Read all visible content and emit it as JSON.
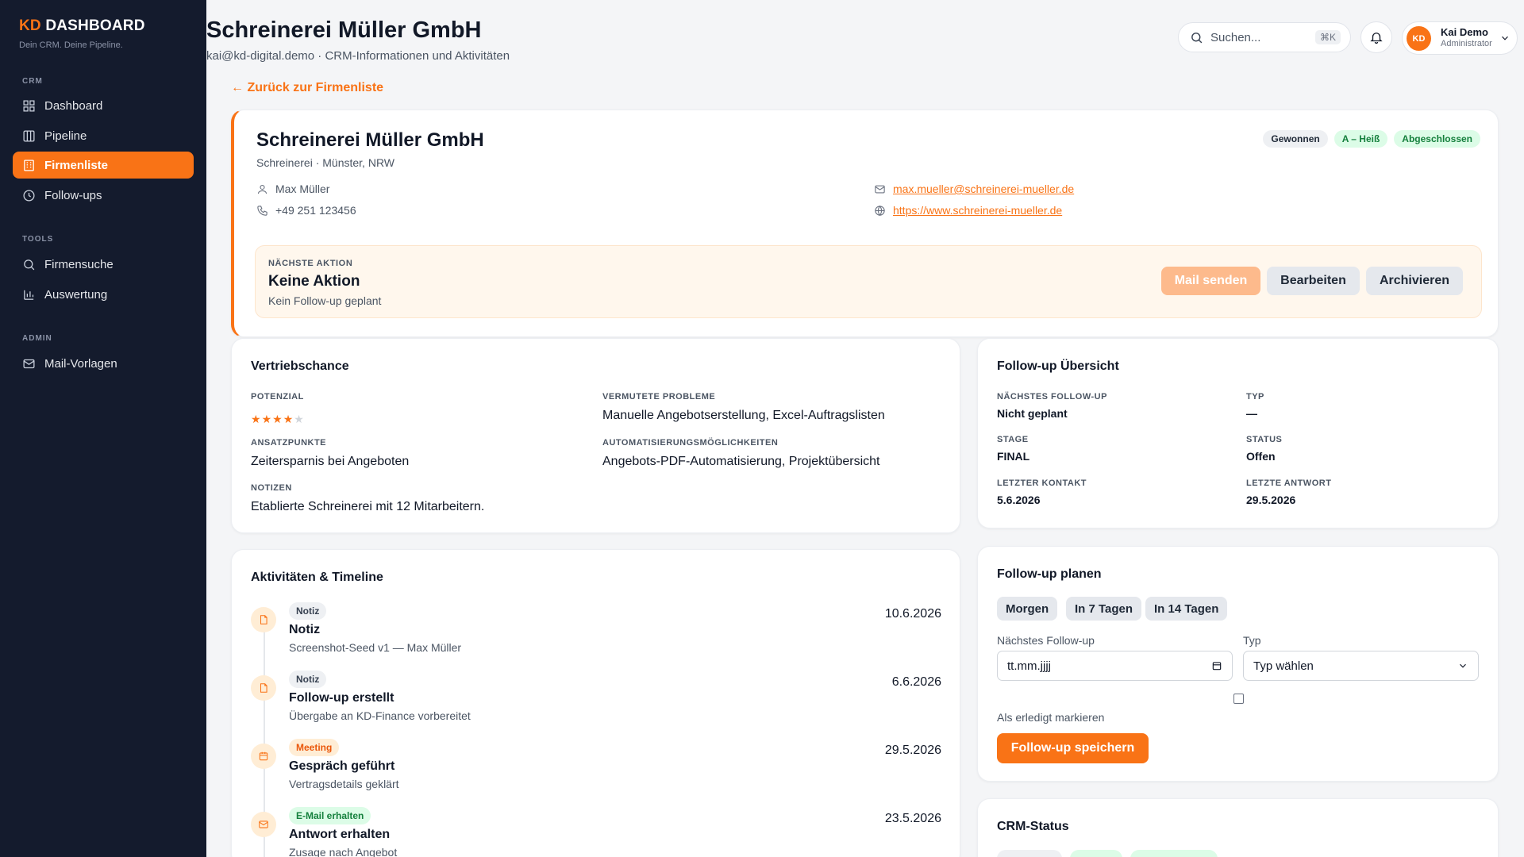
{
  "sidebar": {
    "brand_kd": "KD",
    "brand_rest": " DASHBOARD",
    "tagline": "Dein CRM. Deine Pipeline.",
    "sections": {
      "crm": "CRM",
      "tools": "TOOLS",
      "admin": "ADMIN"
    },
    "items": {
      "dashboard": "Dashboard",
      "pipeline": "Pipeline",
      "firmenliste": "Firmenliste",
      "followups": "Follow-ups",
      "firmensuche": "Firmensuche",
      "auswertung": "Auswertung",
      "mailvorlagen": "Mail-Vorlagen"
    },
    "active": "firmenliste"
  },
  "header": {
    "title": "Schreinerei Müller GmbH",
    "subtitle": "kai@kd-digital.demo · CRM-Informationen und Aktivitäten",
    "search_placeholder": "Suchen...",
    "search_shortcut": "⌘K",
    "user_initials": "KD",
    "user_name": "Kai Demo",
    "user_role": "Administrator"
  },
  "back_link": "← Zurück zur Firmenliste",
  "company": {
    "name": "Schreinerei Müller GmbH",
    "location": "Schreinerei · Münster, NRW",
    "contact_person": "Max Müller",
    "phone": "+49 251 123456",
    "email": "max.mueller@schreinerei-mueller.de",
    "website": "https://www.schreinerei-mueller.de",
    "tags": [
      "Gewonnen",
      "A – Heiß",
      "Abgeschlossen"
    ],
    "next_action": {
      "label": "NÄCHSTE AKTION",
      "title": "Keine Aktion",
      "subtitle": "Kein Follow-up geplant"
    },
    "buttons": {
      "mail": "Mail senden",
      "edit": "Bearbeiten",
      "archive": "Archivieren"
    }
  },
  "opportunity": {
    "title": "Vertriebschance",
    "potential_label": "POTENZIAL",
    "potential_rating": 4,
    "potential_max": 5,
    "problems_label": "VERMUTETE PROBLEME",
    "problems_value": "Manuelle Angebotserstellung, Excel-Auftragslisten",
    "approach_label": "ANSATZPUNKTE",
    "approach_value": "Zeitersparnis bei Angeboten",
    "automation_label": "AUTOMATISIERUNGSMÖGLICHKEITEN",
    "automation_value": "Angebots-PDF-Automatisierung, Projektübersicht",
    "notes_label": "NOTIZEN",
    "notes_value": "Etablierte Schreinerei mit 12 Mitarbeitern."
  },
  "followup_overview": {
    "title": "Follow-up Übersicht",
    "next_label": "NÄCHSTES FOLLOW-UP",
    "next_value": "Nicht geplant",
    "type_label": "TYP",
    "type_value": "—",
    "stage_label": "STAGE",
    "stage_value": "FINAL",
    "status_label": "STATUS",
    "status_value": "Offen",
    "last_contact_label": "LETZTER KONTAKT",
    "last_contact_value": "5.6.2026",
    "last_reply_label": "LETZTE ANTWORT",
    "last_reply_value": "29.5.2026"
  },
  "timeline": {
    "title": "Aktivitäten & Timeline",
    "items": [
      {
        "badge": "Notiz",
        "title": "Notiz",
        "subtitle": "Screenshot-Seed v1 — Max Müller",
        "date": "10.6.2026"
      },
      {
        "badge": "Notiz",
        "title": "Follow-up erstellt",
        "subtitle": "Übergabe an KD-Finance vorbereitet",
        "date": "6.6.2026"
      },
      {
        "badge": "Meeting",
        "title": "Gespräch geführt",
        "subtitle": "Vertragsdetails geklärt",
        "date": "29.5.2026"
      },
      {
        "badge": "E-Mail erhalten",
        "title": "Antwort erhalten",
        "subtitle": "Zusage nach Angebot",
        "date": "23.5.2026"
      }
    ]
  },
  "plan": {
    "title": "Follow-up planen",
    "chips": [
      "Morgen",
      "In 7 Tagen",
      "In 14 Tagen"
    ],
    "next_label": "Nächstes Follow-up",
    "date_placeholder": "tt.mm.jjjj",
    "type_label": "Typ",
    "type_placeholder": "Typ wählen",
    "done_label": "Als erledigt markieren",
    "save": "Follow-up speichern"
  },
  "crm_status": {
    "title": "CRM-Status"
  },
  "colors": {
    "accent": "#f97316",
    "sidebar": "#141b2d",
    "success": "#15803d"
  }
}
